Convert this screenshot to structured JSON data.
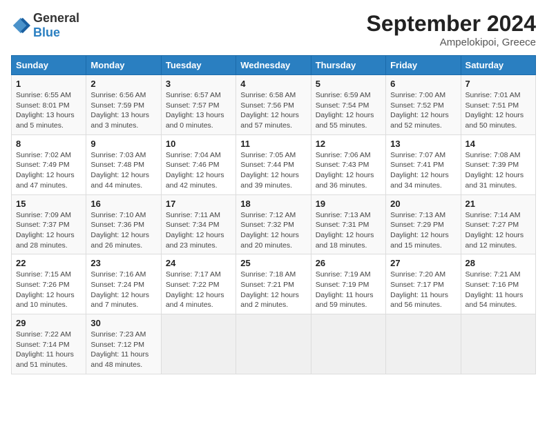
{
  "header": {
    "logo_general": "General",
    "logo_blue": "Blue",
    "month_title": "September 2024",
    "location": "Ampelokipoi, Greece"
  },
  "weekdays": [
    "Sunday",
    "Monday",
    "Tuesday",
    "Wednesday",
    "Thursday",
    "Friday",
    "Saturday"
  ],
  "weeks": [
    [
      {
        "day": "1",
        "sunrise": "6:55 AM",
        "sunset": "8:01 PM",
        "daylight": "13 hours and 5 minutes."
      },
      {
        "day": "2",
        "sunrise": "6:56 AM",
        "sunset": "7:59 PM",
        "daylight": "13 hours and 3 minutes."
      },
      {
        "day": "3",
        "sunrise": "6:57 AM",
        "sunset": "7:57 PM",
        "daylight": "13 hours and 0 minutes."
      },
      {
        "day": "4",
        "sunrise": "6:58 AM",
        "sunset": "7:56 PM",
        "daylight": "12 hours and 57 minutes."
      },
      {
        "day": "5",
        "sunrise": "6:59 AM",
        "sunset": "7:54 PM",
        "daylight": "12 hours and 55 minutes."
      },
      {
        "day": "6",
        "sunrise": "7:00 AM",
        "sunset": "7:52 PM",
        "daylight": "12 hours and 52 minutes."
      },
      {
        "day": "7",
        "sunrise": "7:01 AM",
        "sunset": "7:51 PM",
        "daylight": "12 hours and 50 minutes."
      }
    ],
    [
      {
        "day": "8",
        "sunrise": "7:02 AM",
        "sunset": "7:49 PM",
        "daylight": "12 hours and 47 minutes."
      },
      {
        "day": "9",
        "sunrise": "7:03 AM",
        "sunset": "7:48 PM",
        "daylight": "12 hours and 44 minutes."
      },
      {
        "day": "10",
        "sunrise": "7:04 AM",
        "sunset": "7:46 PM",
        "daylight": "12 hours and 42 minutes."
      },
      {
        "day": "11",
        "sunrise": "7:05 AM",
        "sunset": "7:44 PM",
        "daylight": "12 hours and 39 minutes."
      },
      {
        "day": "12",
        "sunrise": "7:06 AM",
        "sunset": "7:43 PM",
        "daylight": "12 hours and 36 minutes."
      },
      {
        "day": "13",
        "sunrise": "7:07 AM",
        "sunset": "7:41 PM",
        "daylight": "12 hours and 34 minutes."
      },
      {
        "day": "14",
        "sunrise": "7:08 AM",
        "sunset": "7:39 PM",
        "daylight": "12 hours and 31 minutes."
      }
    ],
    [
      {
        "day": "15",
        "sunrise": "7:09 AM",
        "sunset": "7:37 PM",
        "daylight": "12 hours and 28 minutes."
      },
      {
        "day": "16",
        "sunrise": "7:10 AM",
        "sunset": "7:36 PM",
        "daylight": "12 hours and 26 minutes."
      },
      {
        "day": "17",
        "sunrise": "7:11 AM",
        "sunset": "7:34 PM",
        "daylight": "12 hours and 23 minutes."
      },
      {
        "day": "18",
        "sunrise": "7:12 AM",
        "sunset": "7:32 PM",
        "daylight": "12 hours and 20 minutes."
      },
      {
        "day": "19",
        "sunrise": "7:13 AM",
        "sunset": "7:31 PM",
        "daylight": "12 hours and 18 minutes."
      },
      {
        "day": "20",
        "sunrise": "7:13 AM",
        "sunset": "7:29 PM",
        "daylight": "12 hours and 15 minutes."
      },
      {
        "day": "21",
        "sunrise": "7:14 AM",
        "sunset": "7:27 PM",
        "daylight": "12 hours and 12 minutes."
      }
    ],
    [
      {
        "day": "22",
        "sunrise": "7:15 AM",
        "sunset": "7:26 PM",
        "daylight": "12 hours and 10 minutes."
      },
      {
        "day": "23",
        "sunrise": "7:16 AM",
        "sunset": "7:24 PM",
        "daylight": "12 hours and 7 minutes."
      },
      {
        "day": "24",
        "sunrise": "7:17 AM",
        "sunset": "7:22 PM",
        "daylight": "12 hours and 4 minutes."
      },
      {
        "day": "25",
        "sunrise": "7:18 AM",
        "sunset": "7:21 PM",
        "daylight": "12 hours and 2 minutes."
      },
      {
        "day": "26",
        "sunrise": "7:19 AM",
        "sunset": "7:19 PM",
        "daylight": "11 hours and 59 minutes."
      },
      {
        "day": "27",
        "sunrise": "7:20 AM",
        "sunset": "7:17 PM",
        "daylight": "11 hours and 56 minutes."
      },
      {
        "day": "28",
        "sunrise": "7:21 AM",
        "sunset": "7:16 PM",
        "daylight": "11 hours and 54 minutes."
      }
    ],
    [
      {
        "day": "29",
        "sunrise": "7:22 AM",
        "sunset": "7:14 PM",
        "daylight": "11 hours and 51 minutes."
      },
      {
        "day": "30",
        "sunrise": "7:23 AM",
        "sunset": "7:12 PM",
        "daylight": "11 hours and 48 minutes."
      },
      null,
      null,
      null,
      null,
      null
    ]
  ]
}
